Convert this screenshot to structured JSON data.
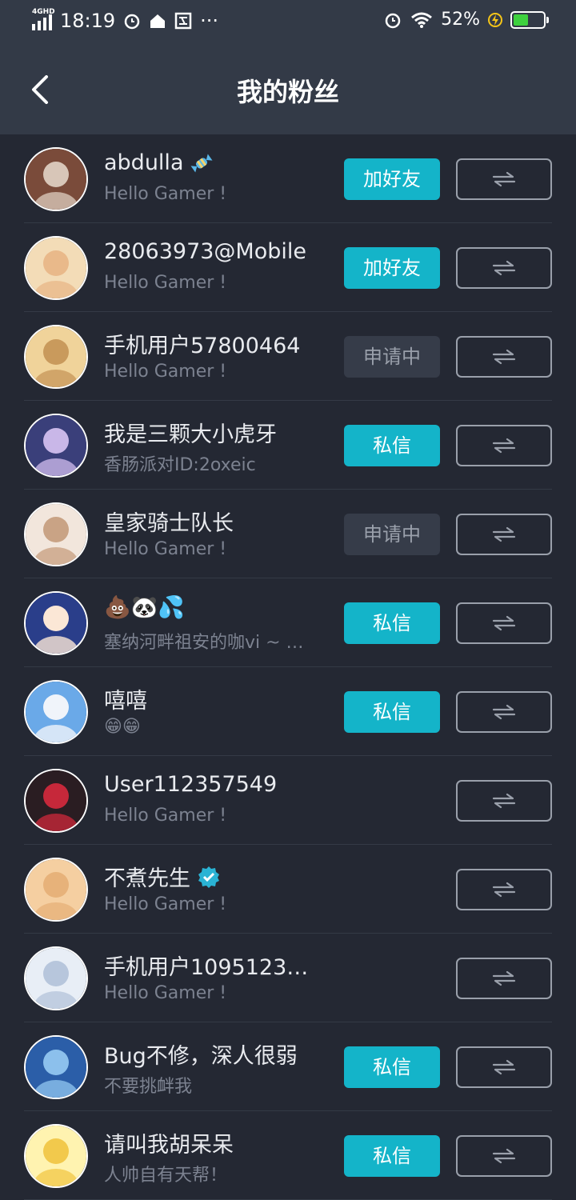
{
  "status_bar": {
    "network": "4GHD",
    "time": "18:19",
    "more": "···",
    "battery_percent": "52%",
    "battery_level": 0.52
  },
  "nav": {
    "title": "我的粉丝"
  },
  "fans": [
    {
      "name": "abdulla",
      "subtitle": "Hello Gamer !",
      "action": "加好友",
      "style": "primary",
      "badge": "candy-icon"
    },
    {
      "name": "28063973@Mobile",
      "subtitle": "Hello Gamer !",
      "action": "加好友",
      "style": "primary"
    },
    {
      "name": "手机用户57800464",
      "subtitle": "Hello Gamer !",
      "action": "申请中",
      "style": "pending"
    },
    {
      "name": "我是三颗大小虎牙",
      "subtitle": "香肠派对ID:2oxeic",
      "action": "私信",
      "style": "primary"
    },
    {
      "name": "皇家骑士队长",
      "subtitle": "Hello Gamer !",
      "action": "申请中",
      "style": "pending"
    },
    {
      "name": "💩🐼💦",
      "subtitle": "塞纳河畔祖安的咖vi ~ …",
      "action": "私信",
      "style": "primary"
    },
    {
      "name": "嘻嘻",
      "subtitle": "😁😁",
      "action": "私信",
      "style": "primary"
    },
    {
      "name": "User112357549",
      "subtitle": "Hello Gamer !",
      "action": "",
      "style": "none"
    },
    {
      "name": "不煮先生",
      "subtitle": "Hello Gamer !",
      "action": "",
      "style": "none",
      "badge": "verified-icon"
    },
    {
      "name": "手机用户1095123…",
      "subtitle": "Hello Gamer !",
      "action": "",
      "style": "none"
    },
    {
      "name": "Bug不修，深人很弱",
      "subtitle": "不要挑衅我",
      "action": "私信",
      "style": "primary"
    },
    {
      "name": "请叫我胡呆呆",
      "subtitle": "人帅自有天帮！",
      "action": "私信",
      "style": "primary"
    }
  ],
  "colors": {
    "accent": "#14b4c9",
    "background": "#242833",
    "header": "#333a47",
    "subtitle": "#7c8290"
  }
}
